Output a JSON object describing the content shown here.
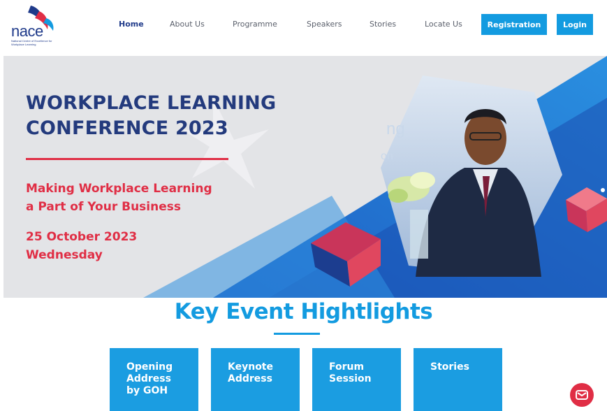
{
  "logo": {
    "word": "nace",
    "tagline": "National Centre of Excellence for Workplace Learning"
  },
  "nav": {
    "items": [
      "Home",
      "About Us",
      "Programme",
      "Speakers",
      "Stories",
      "Locate Us"
    ],
    "active": "Home",
    "registration": "Registration",
    "login": "Login"
  },
  "hero": {
    "title_line1": "WORKPLACE LEARNING",
    "title_line2": "CONFERENCE 2023",
    "subtitle_line1": "Making Workplace Learning",
    "subtitle_line2": "a Part of Your Business",
    "date_line1": "25 October 2023",
    "date_line2": "Wednesday",
    "backdrop_text_1": "ng",
    "backdrop_text_2": "on"
  },
  "highlights": {
    "title": "Key Event Hightlights",
    "cards": [
      {
        "line1": "Opening",
        "line2": "Address",
        "line3": "by GOH"
      },
      {
        "line1": "Keynote",
        "line2": "Address",
        "line3": ""
      },
      {
        "line1": "Forum",
        "line2": "Session",
        "line3": ""
      },
      {
        "line1": "Stories",
        "line2": "",
        "line3": ""
      }
    ]
  },
  "colors": {
    "navy": "#233a7d",
    "red": "#e02e45",
    "blue": "#139be0"
  },
  "icons": {
    "mail": "envelope-icon"
  }
}
